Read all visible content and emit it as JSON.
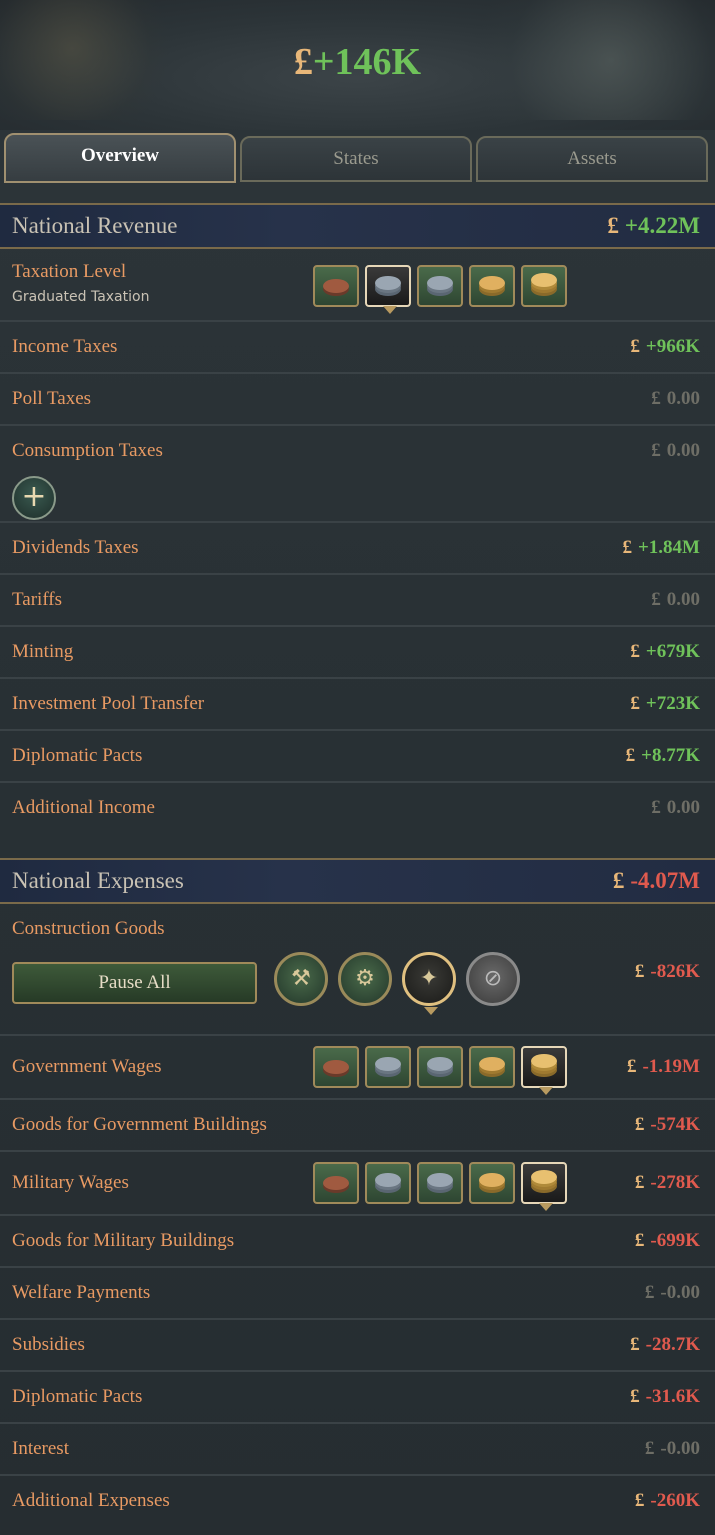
{
  "header": {
    "currency": "£",
    "balance": "+146K"
  },
  "tabs": [
    {
      "label": "Overview",
      "active": true
    },
    {
      "label": "States",
      "active": false
    },
    {
      "label": "Assets",
      "active": false
    }
  ],
  "revenue": {
    "title": "National Revenue",
    "total": "+4.22M",
    "taxation": {
      "label": "Taxation Level",
      "sub": "Graduated Taxation",
      "level_selected": 2,
      "levels": 5
    },
    "rows": [
      {
        "label": "Income Taxes",
        "value": "+966K"
      },
      {
        "label": "Poll Taxes",
        "value": "0.00"
      },
      {
        "label": "Consumption Taxes",
        "value": "0.00"
      },
      {
        "label": "Dividends Taxes",
        "value": "+1.84M"
      },
      {
        "label": "Tariffs",
        "value": "0.00"
      },
      {
        "label": "Minting",
        "value": "+679K"
      },
      {
        "label": "Investment Pool Transfer",
        "value": "+723K"
      },
      {
        "label": "Diplomatic Pacts",
        "value": "+8.77K"
      },
      {
        "label": "Additional Income",
        "value": "0.00"
      }
    ],
    "add_icon": "plus-icon"
  },
  "expenses": {
    "title": "National Expenses",
    "total": "-4.07M",
    "construction": {
      "label": "Construction Goods",
      "pause_label": "Pause All",
      "value": "-826K",
      "icons": [
        "hammer-icon",
        "sawmill-icon",
        "priority-icon",
        "paused-icon"
      ],
      "selected": 2
    },
    "rows": [
      {
        "label": "Government Wages",
        "value": "-1.19M"
      },
      {
        "label": "Goods for Government Buildings",
        "value": "-574K"
      },
      {
        "label": "Military Wages",
        "value": "-278K"
      },
      {
        "label": "Goods for Military Buildings",
        "value": "-699K"
      },
      {
        "label": "Welfare Payments",
        "value": "-0.00"
      },
      {
        "label": "Subsidies",
        "value": "-28.7K"
      },
      {
        "label": "Diplomatic Pacts",
        "value": "-31.6K"
      },
      {
        "label": "Interest",
        "value": "-0.00"
      },
      {
        "label": "Additional Expenses",
        "value": "-260K"
      }
    ],
    "gov_wage_level": 5,
    "mil_wage_level": 5
  },
  "colors": {
    "positive": "#6fc25a",
    "negative": "#e05a4e",
    "zero": "#6e6e66",
    "label": "#e89a63",
    "currency": "#e8b779"
  }
}
